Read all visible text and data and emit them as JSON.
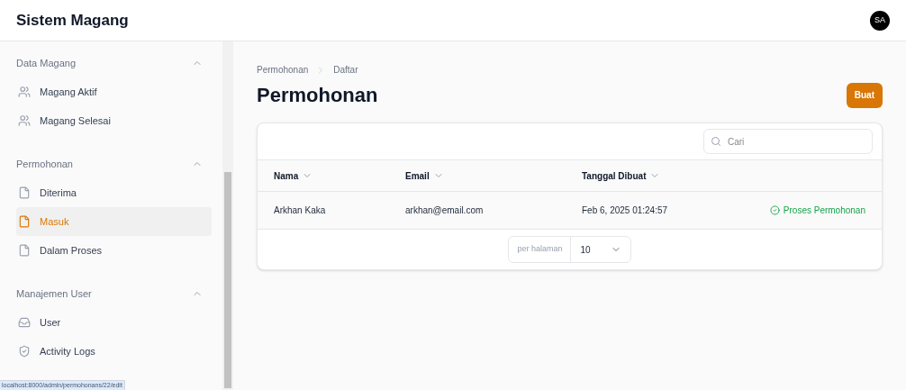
{
  "app_title": "Sistem Magang",
  "avatar": "SA",
  "sidebar": [
    {
      "label": "Data Magang",
      "expanded": true,
      "items": [
        {
          "label": "Magang Aktif",
          "kind": "users",
          "selected": false
        },
        {
          "label": "Magang Selesai",
          "kind": "users",
          "selected": false
        }
      ]
    },
    {
      "label": "Permohonan",
      "expanded": true,
      "items": [
        {
          "label": "Diterima",
          "kind": "file",
          "selected": false
        },
        {
          "label": "Masuk",
          "kind": "file",
          "selected": true
        },
        {
          "label": "Dalam Proses",
          "kind": "file",
          "selected": false
        }
      ]
    },
    {
      "label": "Manajemen User",
      "expanded": true,
      "items": [
        {
          "label": "User",
          "kind": "inbox",
          "selected": false
        },
        {
          "label": "Activity Logs",
          "kind": "shield",
          "selected": false
        }
      ]
    }
  ],
  "breadcrumbs": [
    "Permohonan",
    "Daftar"
  ],
  "page_title": "Permohonan",
  "create_button": "Buat",
  "search": {
    "placeholder": "Cari"
  },
  "table": {
    "columns": [
      "Nama",
      "Email",
      "Tanggal Dibuat"
    ],
    "rows": [
      {
        "cells": [
          "Arkhan Kaka",
          "arkhan@email.com",
          "Feb 6, 2025 01:24:57"
        ],
        "action": "Proses Permohonan"
      }
    ]
  },
  "pagination": {
    "label": "per halaman",
    "value": "10"
  },
  "status_url": "localhost:8000/admin/permohonans/22/edit"
}
